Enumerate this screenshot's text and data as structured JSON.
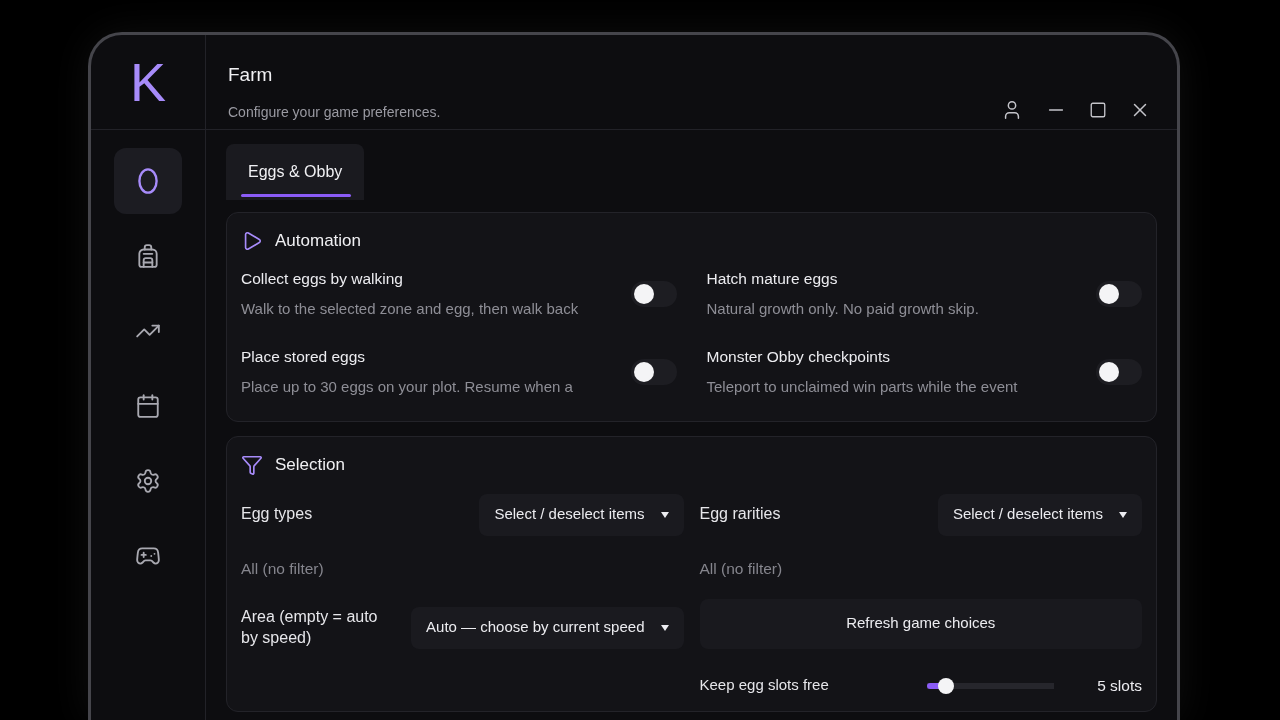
{
  "window": {
    "title": "Farm",
    "subtitle": "Configure your game preferences."
  },
  "sidebar": {
    "logo": "K",
    "items": [
      {
        "selected": true
      },
      {
        "selected": false
      },
      {
        "selected": false
      },
      {
        "selected": false
      },
      {
        "selected": false
      },
      {
        "selected": false
      }
    ]
  },
  "tabs": [
    {
      "label": "Eggs & Obby",
      "selected": true
    }
  ],
  "automation": {
    "title": "Automation",
    "toggles": [
      {
        "title": "Collect eggs by walking",
        "description": "Walk to the selected zone and egg, then walk back",
        "on": false
      },
      {
        "title": "Hatch mature eggs",
        "description": "Natural growth only. No paid growth skip.",
        "on": false
      },
      {
        "title": "Place stored eggs",
        "description": "Place up to 30 eggs on your plot. Resume when a",
        "on": false
      },
      {
        "title": "Monster Obby checkpoints",
        "description": "Teleport to unclaimed win parts while the event",
        "on": false
      }
    ]
  },
  "selection": {
    "title": "Selection",
    "rows": [
      {
        "left": {
          "kind": "select",
          "label": "Egg types",
          "value": "Select / deselect items"
        },
        "right": {
          "kind": "select",
          "label": "Egg rarities",
          "value": "Select / deselect items"
        }
      },
      {
        "left": {
          "kind": "note",
          "text": "All (no filter)"
        },
        "right": {
          "kind": "note",
          "text": "All (no filter)"
        }
      },
      {
        "left": {
          "kind": "select",
          "label": "Area (empty = auto by speed)",
          "value": "Auto — choose by current speed"
        },
        "right": {
          "kind": "button",
          "label": "Refresh game choices"
        }
      },
      {
        "right": {
          "kind": "slider",
          "label": "Keep egg slots free",
          "level": 0.15,
          "reading": "5 slots"
        }
      }
    ]
  }
}
